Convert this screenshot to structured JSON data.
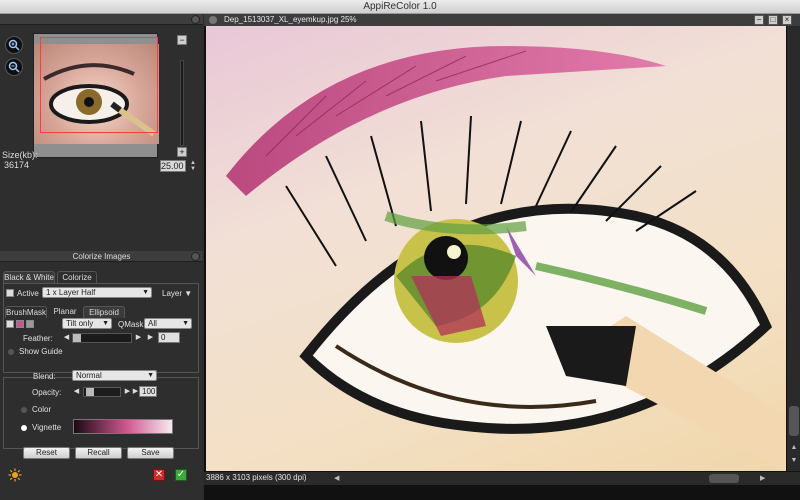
{
  "window": {
    "title": "AppiReColor 1.0"
  },
  "navigator": {
    "size_label": "Size(kb):",
    "size_value": "36174",
    "zoom_value": "25.00",
    "minus": "−",
    "plus": "+"
  },
  "colorize": {
    "section_title": "Colorize Images",
    "tabs": [
      {
        "label": "Black & White"
      },
      {
        "label": "Colorize"
      }
    ],
    "active_label": "Active",
    "layer_select": "1   x Layer Half",
    "layer_button": "Layer",
    "subtabs": [
      {
        "label": "BrushMask"
      },
      {
        "label": "Planar"
      },
      {
        "label": "Ellipsoid"
      }
    ],
    "tilt_select": "Tilt only",
    "qmask_label": "QMask:",
    "qmask_select": "All",
    "feather_label": "Feather:",
    "feather_value": "0",
    "show_guide_label": "Show Guide",
    "blend_label": "Blend:",
    "blend_select": "Normal",
    "opacity_label": "Opacity:",
    "opacity_value": "100",
    "color_label": "Color",
    "vignette_label": "Vignette",
    "buttons": {
      "reset": "Reset",
      "recall": "Recall",
      "save": "Save"
    }
  },
  "image_window": {
    "title": "Dep_1513037_XL_eyemkup.jpg 25%",
    "info": "3886 x 3103 pixels (300 dpi)",
    "minimize": "−",
    "maximize": "□",
    "close": "×"
  },
  "colors": {
    "vignette_start": "#1a0a12",
    "vignette_mid": "#d25a93",
    "vignette_end": "#f6e9ef",
    "accent_pink": "#c8558f"
  }
}
